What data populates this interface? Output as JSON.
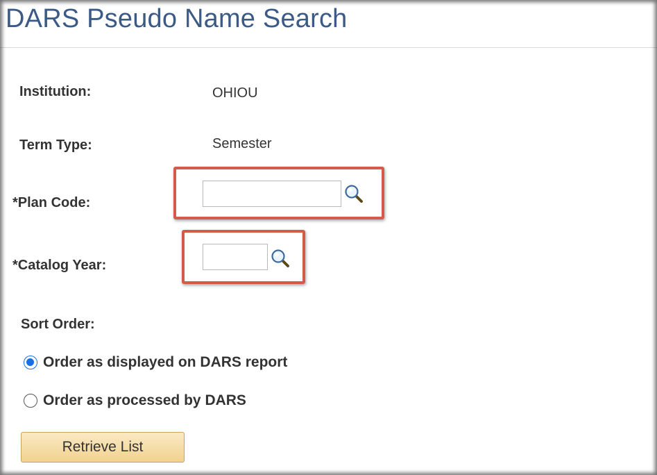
{
  "page": {
    "title": "DARS Pseudo Name Search"
  },
  "fields": {
    "institution": {
      "label": "Institution:",
      "value": "OHIOU"
    },
    "term_type": {
      "label": "Term Type:",
      "value": "Semester"
    },
    "plan_code": {
      "label": "*Plan Code:",
      "value": "",
      "lookup_icon": "magnifier-icon"
    },
    "catalog_year": {
      "label": "*Catalog Year:",
      "value": "",
      "lookup_icon": "magnifier-icon"
    }
  },
  "sort_order": {
    "label": "Sort Order:",
    "options": [
      {
        "label": "Order as displayed on DARS report",
        "selected": true
      },
      {
        "label": "Order as processed by DARS",
        "selected": false
      }
    ]
  },
  "actions": {
    "retrieve_label": "Retrieve List"
  },
  "colors": {
    "title": "#3b5a86",
    "callout_border": "#d45b4c",
    "radio_selected": "#1a6fe6",
    "button_top": "#fbe9c4",
    "button_bottom": "#f1d28f"
  }
}
